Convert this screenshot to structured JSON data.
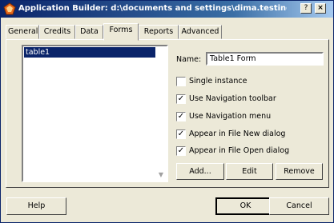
{
  "window": {
    "title": "Application Builder: d:\\documents and settings\\dima.testing\\Мои док..."
  },
  "titlebar_buttons": {
    "help": "?",
    "close": "×"
  },
  "tabs": [
    {
      "label": "General"
    },
    {
      "label": "Credits"
    },
    {
      "label": "Data"
    },
    {
      "label": "Forms"
    },
    {
      "label": "Reports"
    },
    {
      "label": "Advanced"
    }
  ],
  "active_tab": "Forms",
  "forms_list": {
    "items": [
      "table1"
    ],
    "selected": "table1"
  },
  "name_field": {
    "label": "Name:",
    "value": "Table1 Form"
  },
  "options": [
    {
      "label": "Single instance",
      "checked": false
    },
    {
      "label": "Use Navigation toolbar",
      "checked": true
    },
    {
      "label": "Use Navigation menu",
      "checked": true
    },
    {
      "label": "Appear in File New dialog",
      "checked": true
    },
    {
      "label": "Appear in File Open dialog",
      "checked": true
    }
  ],
  "actions": {
    "add": "Add...",
    "edit": "Edit",
    "remove": "Remove"
  },
  "footer": {
    "help": "Help",
    "ok": "OK",
    "cancel": "Cancel"
  },
  "icons": {
    "app": "app-builder-icon",
    "scroll": "scroll-down-arrow-icon"
  }
}
